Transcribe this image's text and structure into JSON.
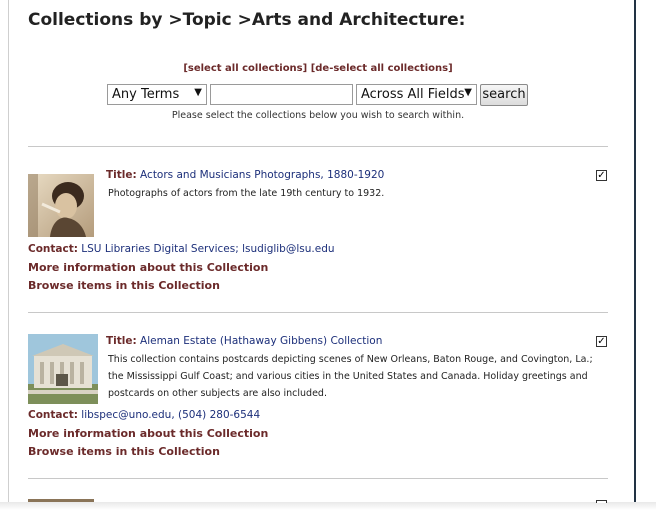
{
  "page": {
    "title": "Collections by >Topic >Arts and Architecture:"
  },
  "selection_links": {
    "select_all": "[select all collections]",
    "deselect_all": "[de-select all collections]"
  },
  "search": {
    "terms_option": "Any Terms",
    "query_value": "",
    "field_option": "Across All Fields",
    "button_label": "search",
    "instructions": "Please select the collections below you wish to search within."
  },
  "collections": [
    {
      "title_label": "Title:",
      "title": "Actors and Musicians Photographs, 1880-1920",
      "checked": true,
      "description": "Photographs of actors from the late 19th century to 1932.",
      "contact_label": "Contact:",
      "contact": "LSU Libraries Digital Services; lsudiglib@lsu.edu",
      "more_info": "More information about this Collection",
      "browse": "Browse items in this Collection"
    },
    {
      "title_label": "Title:",
      "title": "Aleman Estate (Hathaway Gibbens) Collection",
      "checked": true,
      "description": "This collection contains postcards depicting scenes of New Orleans, Baton Rouge, and Covington, La.; the Mississippi Gulf Coast; and various cities in the United States and Canada. Holiday greetings and postcards on other subjects are also included.",
      "contact_label": "Contact:",
      "contact": "libspec@uno.edu, (504) 280-6544",
      "more_info": "More information about this Collection",
      "browse": "Browse items in this Collection"
    }
  ],
  "icons": {
    "check": "✓",
    "dropdown": "chevron-down-icon"
  }
}
